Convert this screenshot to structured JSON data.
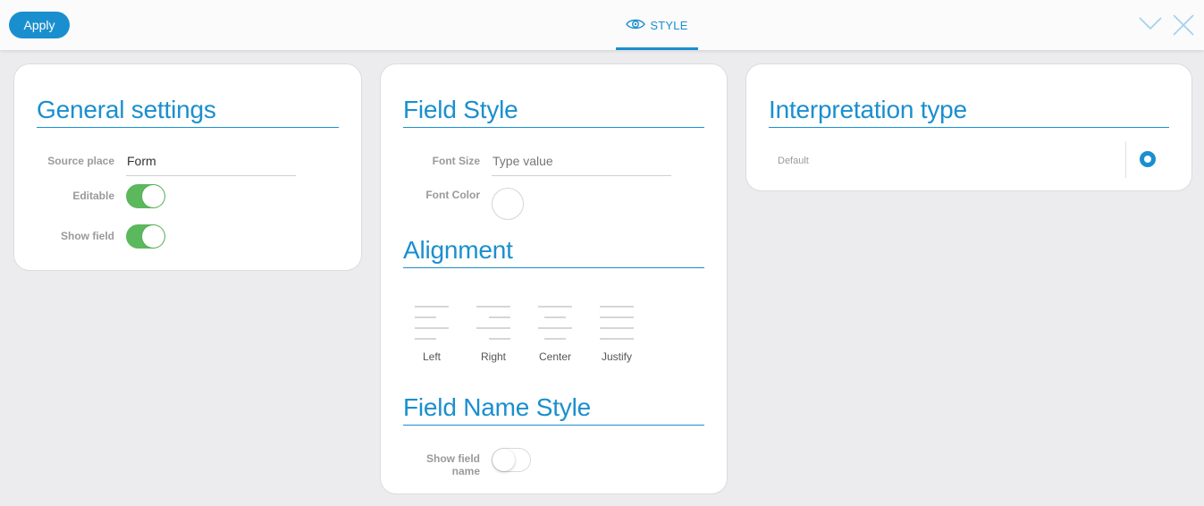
{
  "toolbar": {
    "apply_label": "Apply",
    "tab_label": "STYLE",
    "tab_icon": "eye-icon",
    "collapse_icon": "chevron-down-icon",
    "close_icon": "close-icon"
  },
  "general_settings": {
    "title": "General settings",
    "source_place": {
      "label": "Source place",
      "value": "Form"
    },
    "editable": {
      "label": "Editable",
      "on": true
    },
    "show_field": {
      "label": "Show field",
      "on": true
    }
  },
  "field_style": {
    "title": "Field Style",
    "font_size": {
      "label": "Font Size",
      "placeholder": "Type value"
    },
    "font_color": {
      "label": "Font Color",
      "value": "#ffffff"
    }
  },
  "alignment": {
    "title": "Alignment",
    "options": [
      {
        "label": "Left",
        "icon": "align-left-icon"
      },
      {
        "label": "Right",
        "icon": "align-right-icon"
      },
      {
        "label": "Center",
        "icon": "align-center-icon"
      },
      {
        "label": "Justify",
        "icon": "align-justify-icon"
      }
    ]
  },
  "field_name_style": {
    "title": "Field Name Style",
    "show_field_name": {
      "label_line1": "Show field",
      "label_line2": "name",
      "on": false
    }
  },
  "interpretation": {
    "title": "Interpretation type",
    "options": [
      {
        "label": "Default",
        "selected": true
      }
    ]
  },
  "colors": {
    "accent": "#1a8fcf",
    "toggle_on": "#5cb85c",
    "background": "#ececee"
  }
}
